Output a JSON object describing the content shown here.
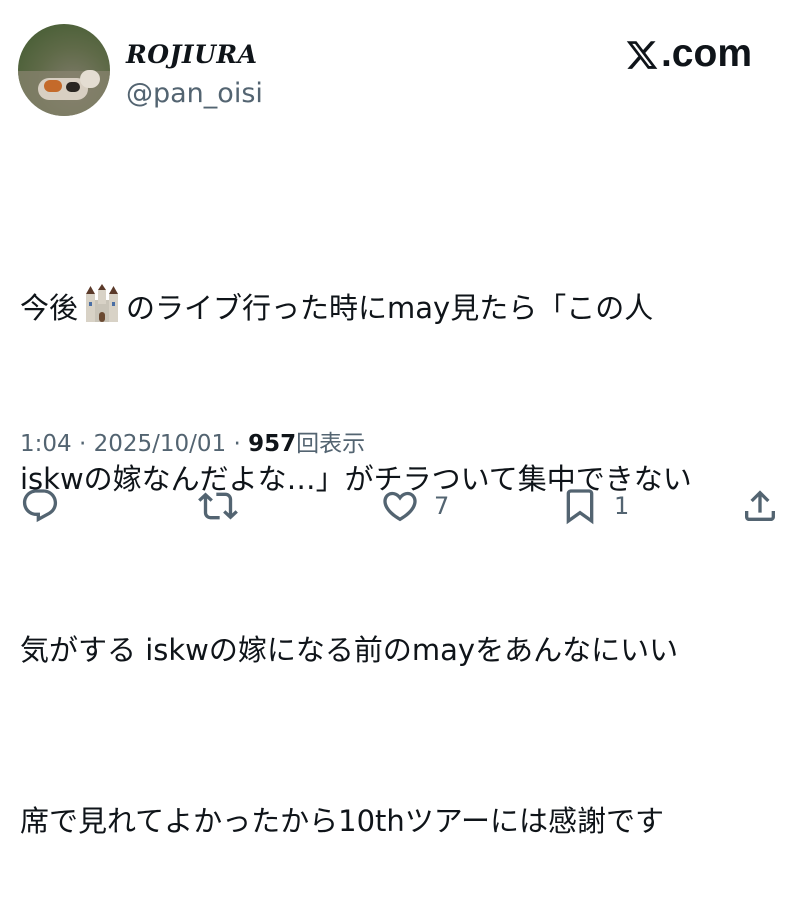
{
  "user": {
    "display_name": "ROJIURA",
    "handle": "@pan_oisi",
    "avatar": "calico-cat-photo"
  },
  "brand": {
    "logo_icon": "x-logo-icon",
    "label": ".com"
  },
  "tweet": {
    "lines": [
      {
        "before": "今後",
        "emoji": "castle-emoji",
        "after": "のライブ行った時にmay見たら「この人"
      },
      {
        "text": "iskwの嫁なんだよな…」がチラついて集中できない"
      },
      {
        "text": "気がする iskwの嫁になる前のmayをあんなにいい"
      },
      {
        "text": "席で見れてよかったから10thツアーには感謝です"
      }
    ]
  },
  "meta": {
    "time": "1:04",
    "separator": "·",
    "date": "2025/10/01",
    "views_count": "957",
    "views_label": "回表示"
  },
  "actions": {
    "reply": {
      "icon": "reply-icon"
    },
    "repost": {
      "icon": "repost-icon"
    },
    "like": {
      "icon": "heart-icon",
      "count": "7"
    },
    "bookmark": {
      "icon": "bookmark-icon",
      "count": "1"
    },
    "share": {
      "icon": "share-icon"
    }
  },
  "colors": {
    "text": "#0f1419",
    "secondary": "#536471",
    "background": "#ffffff"
  }
}
